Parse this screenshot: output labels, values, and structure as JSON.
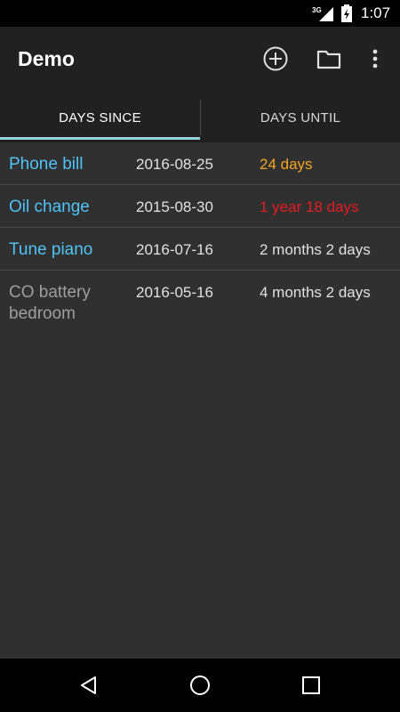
{
  "status_bar": {
    "network": "3G",
    "time": "1:07",
    "icons": [
      "signal-icon",
      "battery-charging-icon"
    ]
  },
  "app_bar": {
    "title": "Demo",
    "actions": [
      "add-circle-icon",
      "folder-icon",
      "overflow-menu-icon"
    ]
  },
  "tabs": [
    {
      "label": "DAYS SINCE",
      "selected": true
    },
    {
      "label": "DAYS UNTIL",
      "selected": false
    }
  ],
  "colors": {
    "accent": "#4fc3f7",
    "indicator": "#8fd3e0",
    "warning": "#f5a623",
    "overdue": "#e51c23",
    "inactive": "#9e9e9e",
    "background": "#303030",
    "toolbar": "#212121"
  },
  "items": [
    {
      "name": "Phone bill",
      "date": "2016-08-25",
      "elapsed": "24 days",
      "name_color": "#4fc3f7",
      "elapsed_color": "#f5a623"
    },
    {
      "name": "Oil change",
      "date": "2015-08-30",
      "elapsed": "1 year 18 days",
      "name_color": "#4fc3f7",
      "elapsed_color": "#e51c23"
    },
    {
      "name": "Tune piano",
      "date": "2016-07-16",
      "elapsed": "2 months 2 days",
      "name_color": "#4fc3f7",
      "elapsed_color": "#e0e0e0"
    },
    {
      "name": "CO battery bedroom",
      "date": "2016-05-16",
      "elapsed": "4 months 2 days",
      "name_color": "#9e9e9e",
      "elapsed_color": "#e0e0e0"
    }
  ],
  "nav_bar": {
    "buttons": [
      "back-icon",
      "home-icon",
      "recents-icon"
    ]
  }
}
